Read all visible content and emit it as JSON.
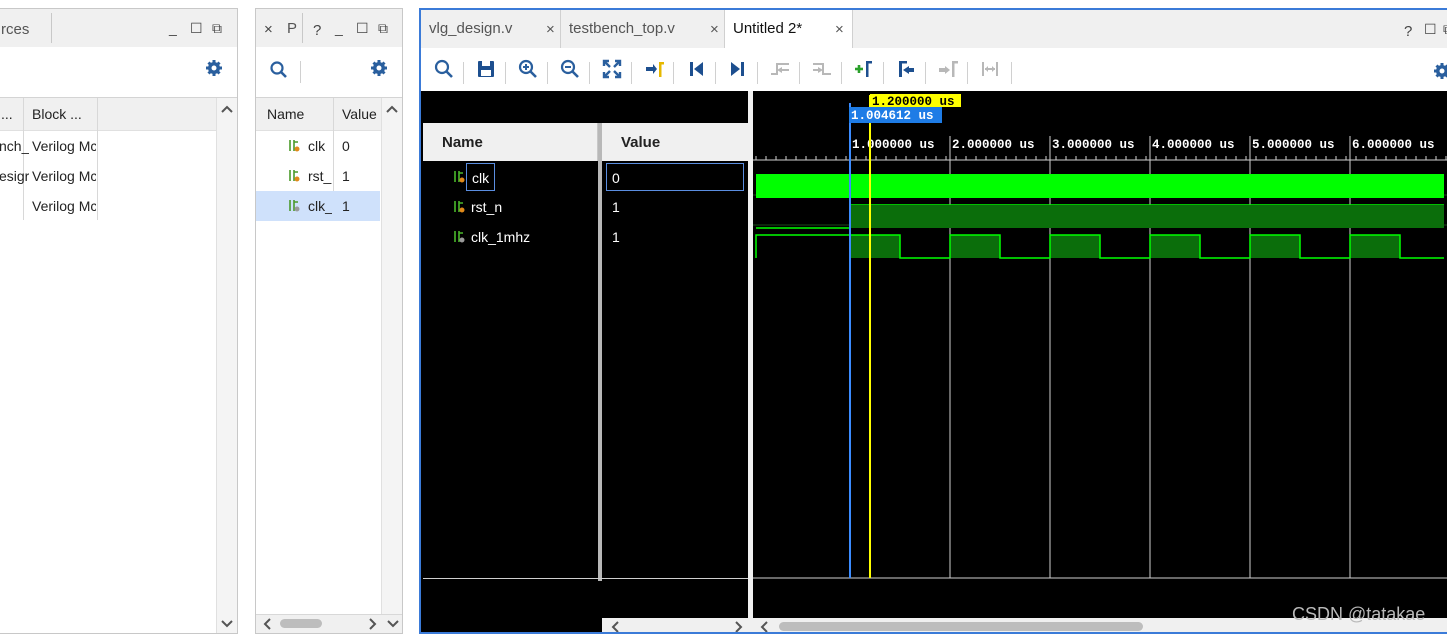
{
  "sources_panel": {
    "title": "rces",
    "columns": [
      "...",
      "Block ..."
    ],
    "rows": [
      {
        "name": "nch_",
        "block": "Verilog Mc"
      },
      {
        "name": "esigr",
        "block": "Verilog Mc"
      },
      {
        "name": "",
        "block": "Verilog Mc"
      }
    ],
    "controls": {
      "minimize": "_",
      "restore": "☐",
      "float": "⧉"
    }
  },
  "objects_panel": {
    "close": "×",
    "title": "P",
    "help": "?",
    "controls": {
      "minimize": "_",
      "restore": "☐",
      "float": "⧉"
    },
    "columns": {
      "name": "Name",
      "value": "Value"
    },
    "rows": [
      {
        "name": "clk",
        "value": "0",
        "selected": false
      },
      {
        "name": "rst_",
        "value": "1",
        "selected": false
      },
      {
        "name": "clk_",
        "value": "1",
        "selected": true
      }
    ]
  },
  "wave_window": {
    "tabs": [
      {
        "label": "vlg_design.v",
        "close": "×",
        "active": false
      },
      {
        "label": "testbench_top.v",
        "close": "×",
        "active": false
      },
      {
        "label": "Untitled 2*",
        "close": "×",
        "active": true
      }
    ],
    "window_controls": {
      "help": "?",
      "restore": "☐",
      "float": "⧉"
    },
    "toolbar_icons": [
      "search-icon",
      "save-icon",
      "zoom-in-icon",
      "zoom-out-icon",
      "zoom-fit-icon",
      "go-to-cursor-icon",
      "go-to-start-icon",
      "go-to-end-icon",
      "previous-transition-icon",
      "next-transition-icon",
      "add-marker-icon",
      "previous-marker-icon",
      "next-marker-icon",
      "swap-cursors-icon"
    ],
    "columns": {
      "name": "Name",
      "value": "Value"
    },
    "signals": [
      {
        "name": "clk",
        "value": "0",
        "focused": true
      },
      {
        "name": "rst_n",
        "value": "1",
        "focused": false
      },
      {
        "name": "clk_1mhz",
        "value": "1",
        "focused": false
      }
    ],
    "cursor_time": "1.200000 us",
    "marker_time": "1.004612 us",
    "time_ruler": [
      "1.000000 us",
      "2.000000 us",
      "3.000000 us",
      "4.000000 us",
      "5.000000 us",
      "6.000000 us"
    ],
    "colors": {
      "wave": "#00ff00",
      "wave_dim": "#0b6e0b",
      "cursor": "#ffff00",
      "marker": "#3c8cff",
      "background": "#000000"
    }
  },
  "watermark": "CSDN @tatakae"
}
